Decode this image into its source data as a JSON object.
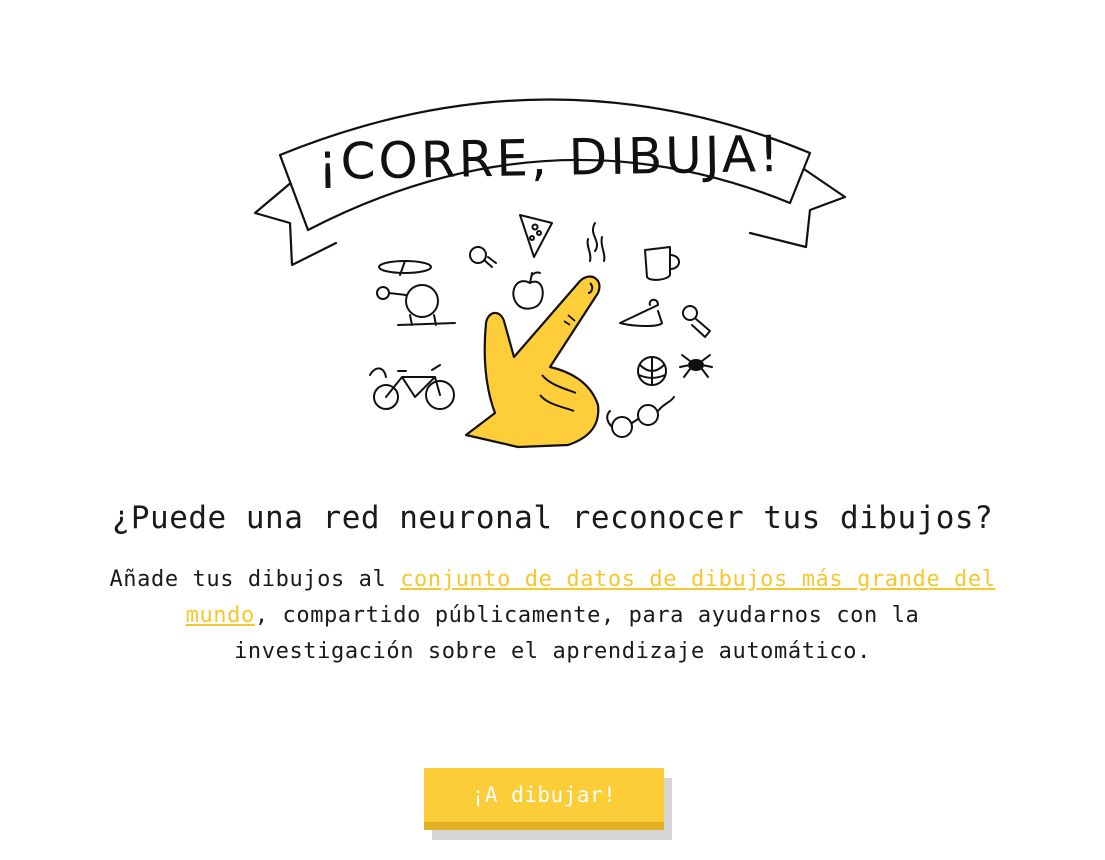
{
  "hero": {
    "banner_title": "¡CORRE, DIBUJA!"
  },
  "main": {
    "headline": "¿Puede una red neuronal reconocer tus dibujos?",
    "description": {
      "before_link": "Añade tus dibujos al ",
      "link_text": "conjunto de datos de dibujos más grande del mundo",
      "after_link": ", compartido públicamente, para ayudarnos con la investigación sobre el aprendizaje automático."
    }
  },
  "cta": {
    "label": "¡A dibujar!"
  },
  "colors": {
    "accent_yellow": "#fbcd38",
    "link_yellow": "#f6c82f",
    "text": "#1a1a1a"
  },
  "icons": [
    "helicopter-icon",
    "lightbulb-icon",
    "pizza-icon",
    "apple-icon",
    "mug-icon",
    "hanger-icon",
    "pushpin-icon",
    "basketball-icon",
    "spider-icon",
    "bicycle-icon",
    "eyeglasses-icon",
    "pointing-hand-illustration"
  ]
}
